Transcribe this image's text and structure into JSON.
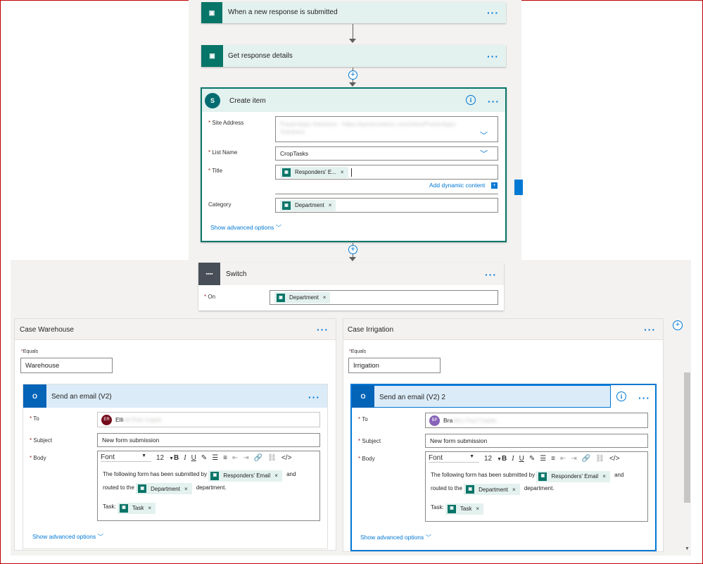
{
  "trigger": {
    "title": "When a new response is submitted"
  },
  "get_details": {
    "title": "Get response details"
  },
  "create_item": {
    "title": "Create item",
    "site_address_label": "Site Address",
    "site_address_value": "PowerApps Solutions - https://quickcreatorx.com/sites/PowerApps-Solutions",
    "list_name_label": "List Name",
    "list_name_value": "CropTasks",
    "title_label": "Title",
    "title_token": "Responders' E...",
    "add_dynamic": "Add dynamic content",
    "category_label": "Category",
    "category_token": "Department",
    "show_advanced": "Show advanced options"
  },
  "switch": {
    "title": "Switch",
    "on_label": "On",
    "on_token": "Department"
  },
  "case_warehouse": {
    "title": "Case Warehouse",
    "equals_label": "Equals",
    "equals_value": "Warehouse",
    "email": {
      "title": "Send an email (V2)",
      "to_label": "To",
      "to_initials": "ER",
      "to_name": "Elli",
      "to_blurred": "ott Rob Capita",
      "subject_label": "Subject",
      "subject_value": "New form submission",
      "body_label": "Body",
      "font": "Font",
      "size": "12",
      "body_text1": "The following form has been submitted by",
      "token_email": "Responders' Email",
      "body_and": "and",
      "body_routed": "routed to the",
      "token_dept": "Department",
      "body_dept": "department.",
      "task_label": "Task:",
      "token_task": "Task",
      "show_advanced": "Show advanced options"
    }
  },
  "case_irrigation": {
    "title": "Case Irrigation",
    "equals_label": "Equals",
    "equals_value": "Irrigation",
    "email": {
      "title": "Send an email (V2) 2",
      "to_label": "To",
      "to_initials": "BP",
      "to_name": "Bra",
      "to_blurred": "dley Paul Capita",
      "subject_label": "Subject",
      "subject_value": "New form submission",
      "body_label": "Body",
      "font": "Font",
      "size": "12",
      "body_text1": "The following form has been submitted by",
      "token_email": "Responders' Email",
      "body_and": "and",
      "body_routed": "routed to the",
      "token_dept": "Department",
      "body_dept": "department.",
      "task_label": "Task:",
      "token_task": "Task",
      "show_advanced": "Show advanced options"
    }
  },
  "colors": {
    "forms": "#077568",
    "sharepoint": "#036c70",
    "outlook": "#0364b8",
    "accent": "#0078d4",
    "required": "#a4262c",
    "frame": "#c00000"
  }
}
